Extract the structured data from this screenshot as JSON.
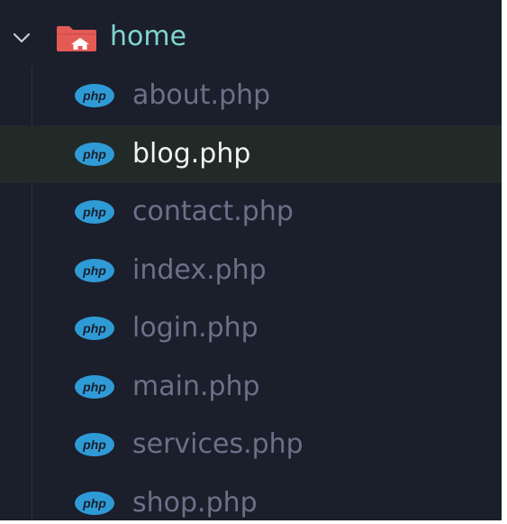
{
  "explorer": {
    "folder": {
      "name": "home",
      "expanded": true,
      "icon": "folder-home-icon",
      "label_color": "#7fd6cf",
      "icon_color": "#e45b55"
    },
    "files": [
      {
        "name": "about.php",
        "icon": "php-icon",
        "selected": false
      },
      {
        "name": "blog.php",
        "icon": "php-icon",
        "selected": true
      },
      {
        "name": "contact.php",
        "icon": "php-icon",
        "selected": false
      },
      {
        "name": "index.php",
        "icon": "php-icon",
        "selected": false
      },
      {
        "name": "login.php",
        "icon": "php-icon",
        "selected": false
      },
      {
        "name": "main.php",
        "icon": "php-icon",
        "selected": false
      },
      {
        "name": "services.php",
        "icon": "php-icon",
        "selected": false
      },
      {
        "name": "shop.php",
        "icon": "php-icon",
        "selected": false
      }
    ],
    "colors": {
      "background": "#1b1e2b",
      "selected_row": "#222a28",
      "file_text": "#6c7088",
      "selected_text": "#f2f2f2",
      "php_icon": "#2f9bd6"
    }
  }
}
